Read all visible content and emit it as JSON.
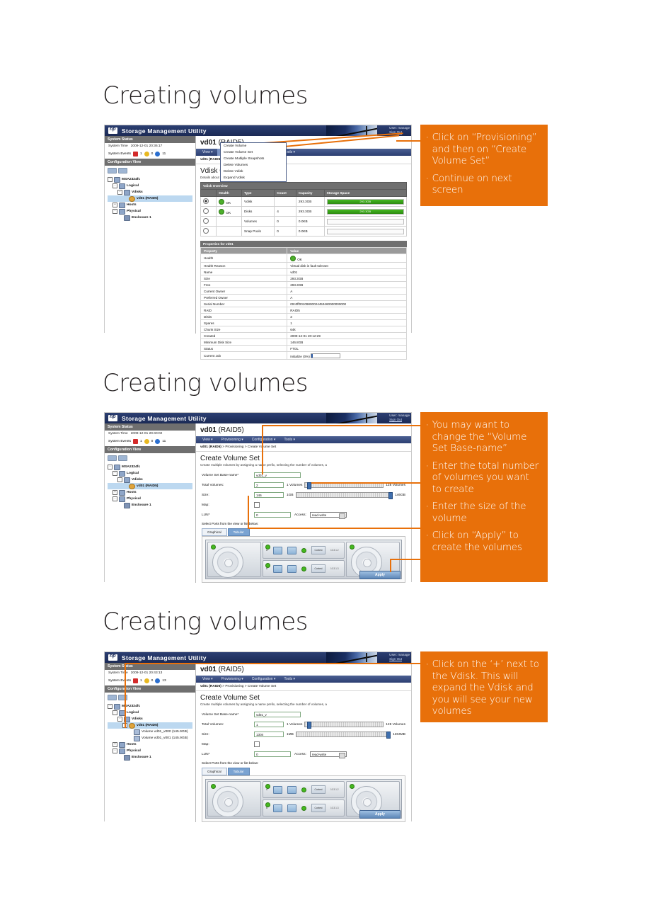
{
  "slides": [
    {
      "title": "Creating volumes",
      "app": {
        "brand": "Storage Management Utility",
        "user_label": "User: manage",
        "signout": "Sign Out",
        "system_status_header": "System Status",
        "system_time_label": "System Time",
        "system_time_value": "2009-12-01 20:36:17",
        "system_events_label": "System Events",
        "events": [
          "1",
          "0",
          "11"
        ],
        "config_view_header": "Configuration View",
        "tree": [
          {
            "label": "MSA2324fc",
            "depth": 0,
            "icon": "array-icon",
            "expander": "-"
          },
          {
            "label": "Logical",
            "depth": 1,
            "icon": "folder-icon",
            "expander": "-"
          },
          {
            "label": "Vdisks",
            "depth": 2,
            "icon": "folder-icon",
            "expander": "-"
          },
          {
            "label": "vd01 (RAID5)",
            "depth": 3,
            "icon": "vdisk-icon",
            "expander": "",
            "selected": true
          },
          {
            "label": "Hosts",
            "depth": 1,
            "icon": "folder-icon",
            "expander": "+"
          },
          {
            "label": "Physical",
            "depth": 1,
            "icon": "folder-icon",
            "expander": "-"
          },
          {
            "label": "Enclosure 1",
            "depth": 2,
            "icon": "enclosure-icon",
            "expander": ""
          }
        ],
        "vdisk_title": "vd01",
        "vdisk_title_suffix": "(RAID5)",
        "menu": [
          "View",
          "Provisioning",
          "Configuration",
          "Tools"
        ],
        "menu_active": "Provisioning",
        "breadcrumb": "vd01 (RAID5)",
        "dropdown": [
          "Create Volume",
          "Create Volume Set",
          "Create Multiple Snapshots",
          "Delete Volumes",
          "Delete Vdisk",
          "Expand Vdisk"
        ],
        "section_heading": "Vdisk Overview",
        "section_sub": "Details about the selected vdisk",
        "table_caption": "Vdisk Overview",
        "table_headers": [
          "",
          "Health",
          "Type",
          "Count",
          "Capacity",
          "Storage Space"
        ],
        "table_rows": [
          {
            "sel": true,
            "health": "OK",
            "type": "Vdisk",
            "count": "",
            "capacity": "293.3GB",
            "bar_pct": 100,
            "bar_label": "293.3GB"
          },
          {
            "sel": false,
            "health": "OK",
            "type": "Disks",
            "count": "4",
            "capacity": "293.3GB",
            "bar_pct": 100,
            "bar_label": "293.3GB"
          },
          {
            "sel": false,
            "health": "",
            "type": "Volumes",
            "count": "0",
            "capacity": "0.0KB",
            "bar_pct": 0,
            "bar_label": ""
          },
          {
            "sel": false,
            "health": "",
            "type": "Snap Pools",
            "count": "0",
            "capacity": "0.0KB",
            "bar_pct": 0,
            "bar_label": ""
          }
        ],
        "props_title": "Properties for vd01",
        "props_head": [
          "Property",
          "Value"
        ],
        "props": [
          [
            "Health",
            "OK"
          ],
          [
            "Health Reason",
            "Virtual disk is fault tolerant"
          ],
          [
            "Name",
            "vd01"
          ],
          [
            "Size",
            "293.3GB"
          ],
          [
            "Free",
            "293.3GB"
          ],
          [
            "Current Owner",
            "A"
          ],
          [
            "Preferred Owner",
            "A"
          ],
          [
            "Serial Number",
            "00c0ff00109800024453460000000000"
          ],
          [
            "RAID",
            "RAID5"
          ],
          [
            "Disks",
            "3"
          ],
          [
            "Spares",
            "1"
          ],
          [
            "Chunk Size",
            "64k"
          ],
          [
            "Created",
            "2009-12-01 20:12:29"
          ],
          [
            "Minimum Disk Size",
            "146.8GB"
          ],
          [
            "Status",
            "FTOL"
          ],
          [
            "Current Job",
            "Initialize (0%)"
          ]
        ]
      },
      "callout": [
        "Click on “Provisioning” and then on “Create Volume Set”",
        "Continue on next screen"
      ]
    },
    {
      "title": "Creating volumes",
      "app": {
        "brand": "Storage Management Utility",
        "user_label": "User: manage",
        "signout": "Sign Out",
        "system_status_header": "System Status",
        "system_time_label": "System Time",
        "system_time_value": "2009-12-01 20:40:02",
        "system_events_label": "System Events",
        "events": [
          "1",
          "0",
          "11"
        ],
        "config_view_header": "Configuration View",
        "tree": [
          {
            "label": "MSA2324fc",
            "depth": 0,
            "icon": "array-icon",
            "expander": "-"
          },
          {
            "label": "Logical",
            "depth": 1,
            "icon": "folder-icon",
            "expander": "-"
          },
          {
            "label": "Vdisks",
            "depth": 2,
            "icon": "folder-icon",
            "expander": "-"
          },
          {
            "label": "vd01 (RAID5)",
            "depth": 3,
            "icon": "vdisk-icon",
            "expander": "",
            "selected": true
          },
          {
            "label": "Hosts",
            "depth": 1,
            "icon": "folder-icon",
            "expander": "+"
          },
          {
            "label": "Physical",
            "depth": 1,
            "icon": "folder-icon",
            "expander": "-"
          },
          {
            "label": "Enclosure 1",
            "depth": 2,
            "icon": "enclosure-icon",
            "expander": ""
          }
        ],
        "vdisk_title": "vd01",
        "vdisk_title_suffix": "(RAID5)",
        "menu": [
          "View",
          "Provisioning",
          "Configuration",
          "Tools"
        ],
        "menu_active": "",
        "breadcrumb_bold": "vd01 (RAID5)",
        "breadcrumb_rest": " > Provisioning > Create Volume Set",
        "form_heading": "Create Volume Set",
        "form_sub": "Create multiple volumes by assigning a name prefix, selecting the number of volumes, a",
        "fields": {
          "basename_label": "Volume Set Base-name*",
          "basename_value": "vd01_v",
          "total_label": "Total Volumes:",
          "total_value": "2",
          "total_min": "1 Volumes",
          "total_max": "128 Volumes",
          "total_knob_pct": 2,
          "size_label": "Size:",
          "size_value": "146",
          "size_min": "1GB",
          "size_max": "146GB",
          "size_knob_pct": 98,
          "map_label": "Map:",
          "lun_label": "LUN*",
          "lun_value": "0",
          "access_label": "Access:",
          "access_value": "read-write"
        },
        "ports_label": "Select Ports from the view or list below:",
        "tabs": [
          "Graphical",
          "Tabular"
        ],
        "tab_active": "Tabular",
        "apply_label": "Apply",
        "enclosure_ports": [
          "A",
          "B"
        ],
        "enclosure_ips": [
          "10.3.1.2",
          "10.3.1.3"
        ],
        "enclosure_eth": [
          "Contest",
          "Contest"
        ]
      },
      "callout": [
        "You may want to change the “Volume Set Base-name”",
        "Enter the total number of volumes you want to create",
        "Enter the size of the volume",
        "Click on “Apply” to create the volumes"
      ]
    },
    {
      "title": "Creating volumes",
      "app": {
        "brand": "Storage Management Utility",
        "user_label": "User: manage",
        "signout": "Sign Out",
        "system_status_header": "System Status",
        "system_time_label": "System Time",
        "system_time_value": "2009-12-01 20:43:13",
        "system_events_label": "System Events",
        "events": [
          "1",
          "0",
          "13"
        ],
        "config_view_header": "Configuration View",
        "tree": [
          {
            "label": "MSA2324fc",
            "depth": 0,
            "icon": "array-icon",
            "expander": "-"
          },
          {
            "label": "Logical",
            "depth": 1,
            "icon": "folder-icon",
            "expander": "-"
          },
          {
            "label": "Vdisks",
            "depth": 2,
            "icon": "folder-icon",
            "expander": "-"
          },
          {
            "label": "vd01 (RAID5)",
            "depth": 3,
            "icon": "vdisk-icon",
            "expander": "-",
            "selected": true
          },
          {
            "label": "Volume vd01_v000 (145.9GB)",
            "depth": 4,
            "icon": "volume-icon",
            "expander": ""
          },
          {
            "label": "Volume vd01_v001 (145.9GB)",
            "depth": 4,
            "icon": "volume-icon",
            "expander": ""
          },
          {
            "label": "Hosts",
            "depth": 1,
            "icon": "folder-icon",
            "expander": "+"
          },
          {
            "label": "Physical",
            "depth": 1,
            "icon": "folder-icon",
            "expander": "-"
          },
          {
            "label": "Enclosure 1",
            "depth": 2,
            "icon": "enclosure-icon",
            "expander": ""
          }
        ],
        "vdisk_title": "vd01",
        "vdisk_title_suffix": "(RAID5)",
        "menu": [
          "View",
          "Provisioning",
          "Configuration",
          "Tools"
        ],
        "menu_active": "",
        "breadcrumb_bold": "vd01 (RAID5)",
        "breadcrumb_rest": " > Provisioning > Create Volume Set",
        "form_heading": "Create Volume Set",
        "form_sub": "Create multiple volumes by assigning a name prefix, selecting the number of volumes, a",
        "fields": {
          "basename_label": "Volume Set Base-name*",
          "basename_value": "vd01_v",
          "total_label": "Total Volumes:",
          "total_value": "1",
          "total_min": "1 Volumes",
          "total_max": "128 Volumes",
          "total_knob_pct": 2,
          "size_label": "Size:",
          "size_value": "1304",
          "size_min": "1MB",
          "size_max": "1304MB",
          "size_knob_pct": 98,
          "map_label": "Map:",
          "lun_label": "LUN*",
          "lun_value": "0",
          "access_label": "Access:",
          "access_value": "read-write"
        },
        "ports_label": "Select Ports from the view or list below:",
        "tabs": [
          "Graphical",
          "Tabular"
        ],
        "tab_active": "Tabular",
        "apply_label": "Apply",
        "enclosure_ports": [
          "A",
          "B"
        ],
        "enclosure_ips": [
          "10.3.1.2",
          "10.3.1.3"
        ],
        "enclosure_eth": [
          "Contest",
          "Contest"
        ]
      },
      "callout": [
        "Click on the ‘+’ next to the Vdisk. This will expand the Vdisk and you will see your new volumes"
      ]
    }
  ],
  "colors": {
    "accent_orange": "#e8700a",
    "hp_blue": "#2c3f72",
    "panel_gray": "#6f6f6f",
    "select_blue": "#bcd8f0",
    "ok_green": "#4caf2a"
  }
}
